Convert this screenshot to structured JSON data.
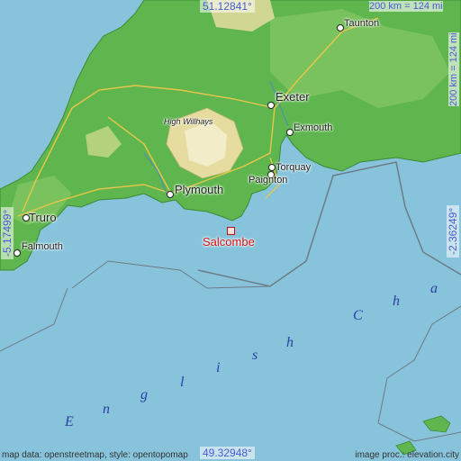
{
  "coords": {
    "top": "51.12841°",
    "bottom": "49.32948°",
    "left": "-5.17499°",
    "right": "-2.36249°"
  },
  "scale": {
    "horizontal": "200 km = 124 mi",
    "vertical": "200 km = 124 mi"
  },
  "places": {
    "taunton": "Taunton",
    "exeter": "Exeter",
    "exmouth": "Exmouth",
    "high_willhays": "High Willhays",
    "torquay": "Torquay",
    "paignton": "Paignton",
    "plymouth": "Plymouth",
    "truro": "Truro",
    "falmouth": "Falmouth",
    "salcombe": "Salcombe"
  },
  "sea_label": [
    "E",
    "n",
    "g",
    "l",
    "i",
    "s",
    "h",
    "C",
    "h",
    "a"
  ],
  "credits": {
    "left": "map data: openstreetmap, style: opentopomap",
    "right": "image proc.: elevation.city"
  },
  "colors": {
    "sea": "#87c4dc",
    "land": "#5fb64e",
    "highland": "#e6dca0",
    "accent_marker": "#d01010",
    "coord_text": "#4a5bd4"
  }
}
